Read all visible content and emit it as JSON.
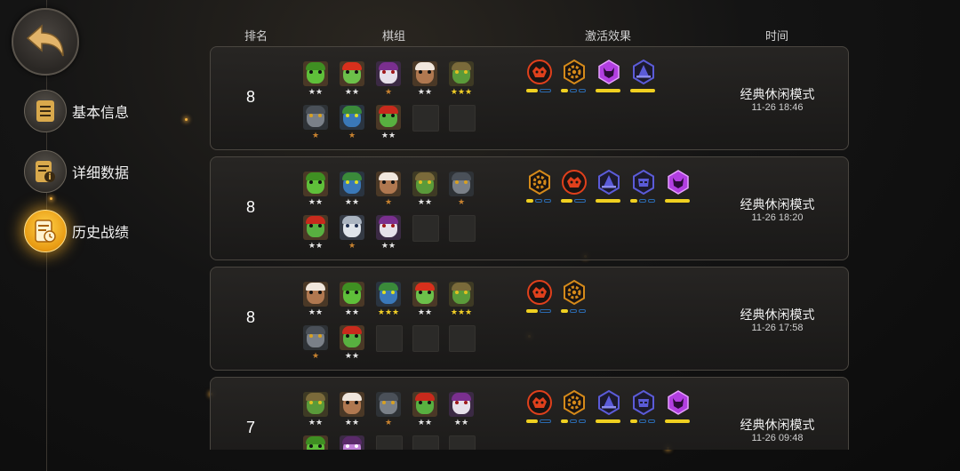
{
  "sidebar": {
    "items": [
      {
        "label": "基本信息",
        "icon": "document-icon"
      },
      {
        "label": "详细数据",
        "icon": "info-document-icon"
      },
      {
        "label": "历史战绩",
        "icon": "history-document-icon",
        "active": true
      }
    ]
  },
  "header": {
    "rank": "排名",
    "deck": "棋组",
    "synergy": "激活效果",
    "time": "时间"
  },
  "matches": [
    {
      "rank": "8",
      "mode": "经典休闲模式",
      "time": "11-26 18:46",
      "units": [
        {
          "type": "goblin",
          "stars": "★★",
          "tier": "silver"
        },
        {
          "type": "bandit",
          "stars": "★★",
          "tier": "silver"
        },
        {
          "type": "demon",
          "stars": "★",
          "tier": "bronze"
        },
        {
          "type": "turban",
          "stars": "★★",
          "tier": "silver"
        },
        {
          "type": "orc",
          "stars": "★★★",
          "tier": "gold"
        },
        {
          "type": "mech",
          "stars": "★",
          "tier": "bronze"
        },
        {
          "type": "robot",
          "stars": "★",
          "tier": "bronze"
        },
        {
          "type": "bandit2",
          "stars": "★★",
          "tier": "silver"
        }
      ],
      "empty_slots": 2,
      "synergies": [
        {
          "icon": "beast-icon",
          "color": "#e0401c",
          "bar": [
            1,
            0
          ]
        },
        {
          "icon": "gear-icon",
          "color": "#d58a1a",
          "bar": [
            1,
            0,
            0
          ]
        },
        {
          "icon": "demon-icon",
          "color": "#b13ee0",
          "bar": [
            1
          ]
        },
        {
          "icon": "mage-hat-icon",
          "color": "#5b5bd8",
          "bar": [
            1
          ]
        }
      ]
    },
    {
      "rank": "8",
      "mode": "经典休闲模式",
      "time": "11-26 18:20",
      "units": [
        {
          "type": "goblin",
          "stars": "★★",
          "tier": "silver"
        },
        {
          "type": "robot",
          "stars": "★★",
          "tier": "silver"
        },
        {
          "type": "turban",
          "stars": "★",
          "tier": "bronze"
        },
        {
          "type": "orc",
          "stars": "★★",
          "tier": "silver"
        },
        {
          "type": "mech",
          "stars": "★",
          "tier": "bronze"
        },
        {
          "type": "bandit2",
          "stars": "★★",
          "tier": "silver"
        },
        {
          "type": "ghost",
          "stars": "★",
          "tier": "bronze"
        },
        {
          "type": "demon",
          "stars": "★★",
          "tier": "silver"
        }
      ],
      "empty_slots": 2,
      "synergies": [
        {
          "icon": "gear-icon",
          "color": "#d58a1a",
          "bar": [
            1,
            0,
            0
          ]
        },
        {
          "icon": "beast-icon",
          "color": "#e0401c",
          "bar": [
            1,
            0
          ]
        },
        {
          "icon": "mage-hat-icon",
          "color": "#5b5bd8",
          "bar": [
            1
          ]
        },
        {
          "icon": "assassin-icon",
          "color": "#5b5bd8",
          "bar": [
            1,
            0,
            0
          ]
        },
        {
          "icon": "demon-icon",
          "color": "#b13ee0",
          "bar": [
            1
          ]
        }
      ]
    },
    {
      "rank": "8",
      "mode": "经典休闲模式",
      "time": "11-26 17:58",
      "units": [
        {
          "type": "turban",
          "stars": "★★",
          "tier": "silver"
        },
        {
          "type": "goblin",
          "stars": "★★",
          "tier": "silver"
        },
        {
          "type": "robot",
          "stars": "★★★",
          "tier": "gold"
        },
        {
          "type": "bandit",
          "stars": "★★",
          "tier": "silver"
        },
        {
          "type": "orc",
          "stars": "★★★",
          "tier": "gold"
        },
        {
          "type": "mech",
          "stars": "★",
          "tier": "bronze"
        },
        {
          "type": "bandit2",
          "stars": "★★",
          "tier": "silver"
        }
      ],
      "empty_slots": 3,
      "synergies": [
        {
          "icon": "beast-icon",
          "color": "#e0401c",
          "bar": [
            1,
            0
          ]
        },
        {
          "icon": "gear-icon",
          "color": "#d58a1a",
          "bar": [
            1,
            0,
            0
          ]
        }
      ]
    },
    {
      "rank": "7",
      "mode": "经典休闲模式",
      "time": "11-26 09:48",
      "units": [
        {
          "type": "orc",
          "stars": "★★",
          "tier": "silver"
        },
        {
          "type": "turban",
          "stars": "★★",
          "tier": "silver"
        },
        {
          "type": "mech",
          "stars": "★",
          "tier": "bronze"
        },
        {
          "type": "bandit2",
          "stars": "★★",
          "tier": "silver"
        },
        {
          "type": "demon",
          "stars": "★★",
          "tier": "silver"
        },
        {
          "type": "goblin",
          "stars": "",
          "tier": "silver"
        },
        {
          "type": "mask",
          "stars": "",
          "tier": "silver"
        }
      ],
      "empty_slots": 3,
      "synergies": [
        {
          "icon": "beast-icon",
          "color": "#e0401c",
          "bar": [
            1,
            0
          ]
        },
        {
          "icon": "gear-icon",
          "color": "#d58a1a",
          "bar": [
            1,
            0,
            0
          ]
        },
        {
          "icon": "mage-hat-icon",
          "color": "#5b5bd8",
          "bar": [
            1
          ]
        },
        {
          "icon": "assassin-icon",
          "color": "#5b5bd8",
          "bar": [
            1,
            0,
            0
          ]
        },
        {
          "icon": "demon-icon",
          "color": "#b13ee0",
          "bar": [
            1
          ]
        }
      ]
    }
  ]
}
